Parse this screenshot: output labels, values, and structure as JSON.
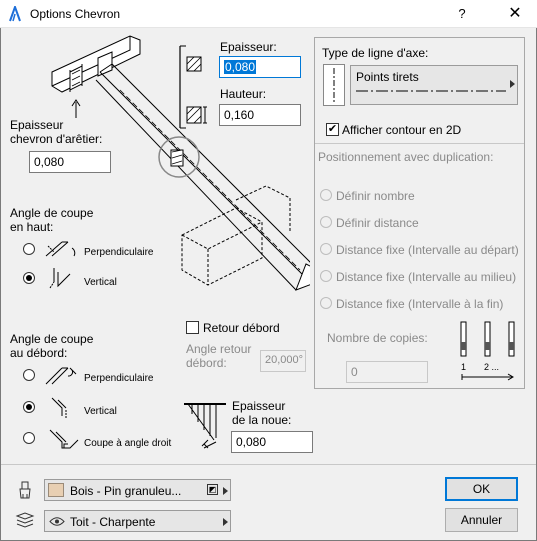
{
  "window": {
    "title": "Options Chevron",
    "help": "?",
    "close": "✕"
  },
  "left": {
    "ridge_thickness_label_1": "Epaisseur",
    "ridge_thickness_label_2": "chevron d'arêtier:",
    "ridge_thickness_value": "0,080",
    "top_cut_label_1": "Angle de coupe",
    "top_cut_label_2": "en haut:",
    "top_cut_options": [
      "Perpendiculaire",
      "Vertical"
    ],
    "overhang_cut_label_1": "Angle de coupe",
    "overhang_cut_label_2": "au débord:",
    "overhang_cut_options": [
      "Perpendiculaire",
      "Vertical",
      "Coupe à angle droit"
    ]
  },
  "center": {
    "thickness_label": "Epaisseur:",
    "thickness_value": "0,080",
    "height_label": "Hauteur:",
    "height_value": "0,160",
    "return_overhang_label": "Retour débord",
    "return_angle_label_1": "Angle retour",
    "return_angle_label_2": "débord:",
    "return_angle_value": "20,000°",
    "valley_thickness_label_1": "Epaisseur",
    "valley_thickness_label_2": "de la noue:",
    "valley_thickness_value": "0,080"
  },
  "right": {
    "axis_line_type_label": "Type de ligne d'axe:",
    "line_type_value": "Points tirets",
    "show_outline_label": "Afficher contour en 2D",
    "positioning_label": "Positionnement avec duplication:",
    "positioning_options": [
      "Définir nombre",
      "Définir distance",
      "Distance fixe (Intervalle au départ)",
      "Distance fixe (Intervalle au milieu)",
      "Distance fixe (Intervalle à la fin)"
    ],
    "copies_label": "Nombre de copies:",
    "copies_value": "0",
    "copies_axis_1": "1",
    "copies_axis_2": "2 ..."
  },
  "bottom": {
    "material_value": "Bois - Pin granuleu...",
    "layer_value": "Toit - Charpente",
    "ok_label": "OK",
    "cancel_label": "Annuler"
  },
  "colors": {
    "accent": "#0078d7",
    "material_swatch": "#e8cfb2"
  }
}
